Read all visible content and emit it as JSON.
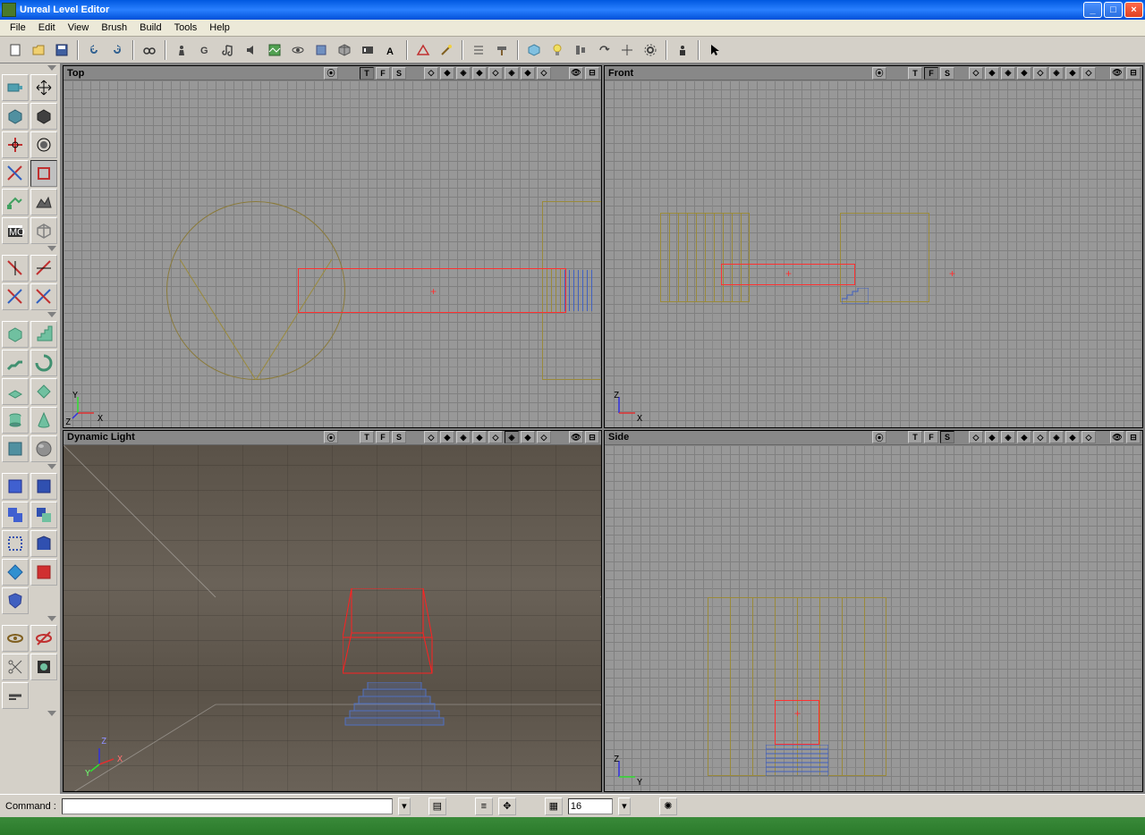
{
  "window": {
    "title": "Unreal Level Editor"
  },
  "menu": {
    "items": [
      "File",
      "Edit",
      "View",
      "Brush",
      "Build",
      "Tools",
      "Help"
    ]
  },
  "viewports": {
    "top_left": {
      "title": "Top",
      "axes": [
        "X",
        "Y",
        "Z"
      ]
    },
    "top_right": {
      "title": "Front",
      "axes": [
        "X",
        "Z"
      ]
    },
    "bottom_left": {
      "title": "Dynamic Light",
      "axes": [
        "X",
        "Y",
        "Z"
      ]
    },
    "bottom_right": {
      "title": "Side",
      "axes": [
        "Y",
        "Z"
      ]
    },
    "toggle_labels": [
      "T",
      "F",
      "S"
    ]
  },
  "command_bar": {
    "label": "Command :",
    "value": "",
    "grid_value": "16"
  },
  "colors": {
    "brush_red": "#ff3030",
    "brush_olive": "#9a8a3a",
    "brush_blue": "#4060c0",
    "titlebar": "#0058e0"
  }
}
